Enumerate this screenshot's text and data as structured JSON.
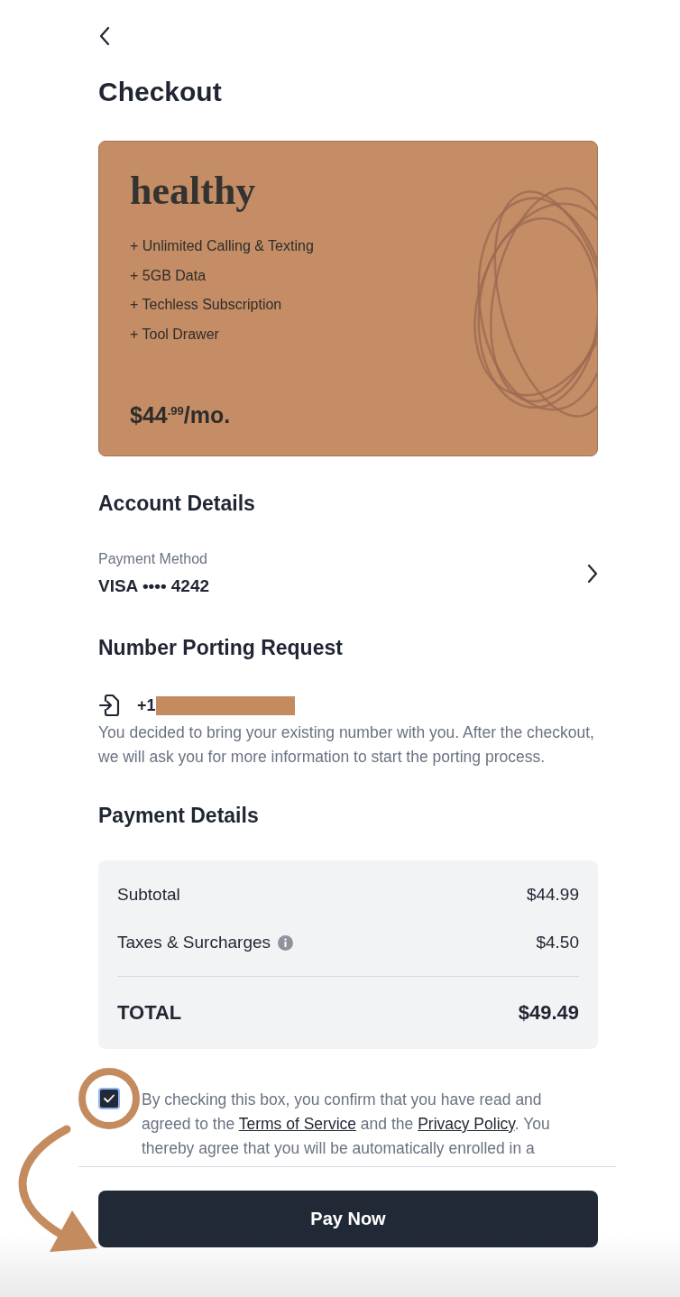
{
  "title": "Checkout",
  "plan_card": {
    "brand": "healthy",
    "features": [
      "Unlimited Calling & Texting",
      "5GB Data",
      "Techless Subscription",
      "Tool Drawer"
    ],
    "feature_prefix": "+",
    "price": "$44$^{.99}$/mo."
  },
  "account_details": {
    "heading": "Account Details",
    "label": "Payment Method",
    "value": "VISA •••• 4242"
  },
  "number_porting": {
    "heading": "Number Porting Request",
    "phone": "+1",
    "redacted": true,
    "description": "You decided to bring your existing number with you. After the checkout, we will ask you for more information to start the porting process."
  },
  "payment_details": {
    "heading": "Payment Details",
    "rows": [
      {
        "kind": "line",
        "label": "Subtotal",
        "value": "$44.99",
        "info": false
      },
      {
        "kind": "line",
        "label": "Taxes & Surcharges",
        "value": "$4.50",
        "info": true
      },
      {
        "kind": "total",
        "label": "TOTAL",
        "value": "$49.49",
        "info": false
      }
    ]
  },
  "consent": {
    "checked": true,
    "parts": [
      {
        "kind": "text",
        "text": "By checking this box, you confirm that you have read and agreed to the "
      },
      {
        "kind": "link",
        "text": "Terms of Service"
      },
      {
        "kind": "text",
        "text": " and the "
      },
      {
        "kind": "link",
        "text": "Privacy Policy"
      },
      {
        "kind": "text",
        "text": ". You thereby agree that you will be automatically enrolled in a"
      }
    ]
  },
  "pay_button": "Pay Now"
}
